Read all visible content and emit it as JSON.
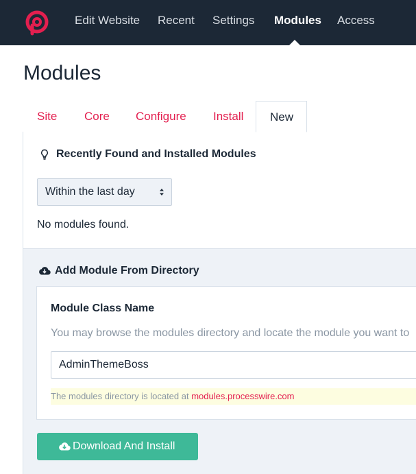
{
  "topnav": {
    "items": [
      "Edit Website",
      "Recent",
      "Settings",
      "Modules",
      "Access"
    ],
    "active": "Modules"
  },
  "page_title": "Modules",
  "tabs": [
    "Site",
    "Core",
    "Configure",
    "Install",
    "New"
  ],
  "recent": {
    "heading": "Recently Found and Installed Modules",
    "select_value": "Within the last day",
    "empty_text": "No modules found."
  },
  "add_module": {
    "heading": "Add Module From Directory",
    "field_label": "Module Class Name",
    "field_description": "You may browse the modules directory and locate the module you want to",
    "field_value": "AdminThemeBoss",
    "notice_text": "The modules directory is located at ",
    "notice_link": "modules.processwire.com",
    "button_label": "Download And Install"
  },
  "colors": {
    "topbar": "#1c2836",
    "accent": "#e31f4f",
    "button": "#3eb998"
  }
}
